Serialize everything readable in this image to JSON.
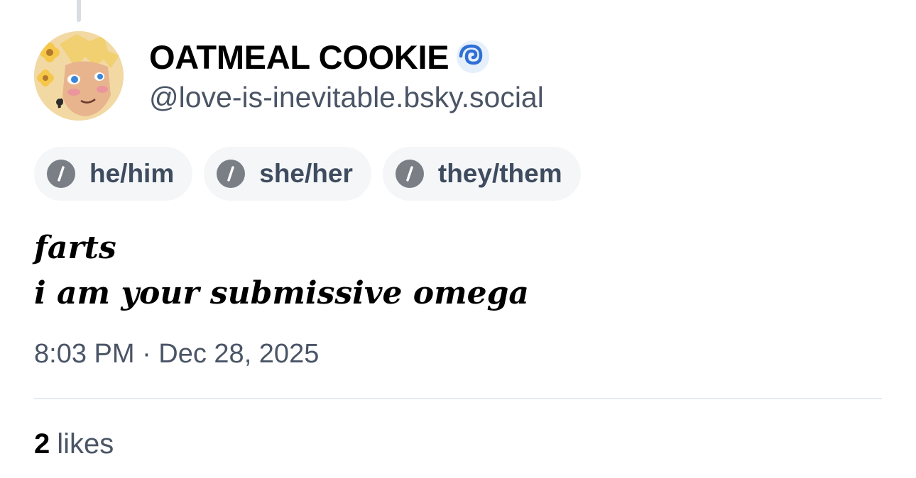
{
  "author": {
    "display_name": "OATMEAL COOKIE",
    "handle": "@love-is-inevitable.bsky.social",
    "name_emoji": "cyclone-icon"
  },
  "pronouns": [
    {
      "label": "he/him",
      "icon": "slash-icon"
    },
    {
      "label": "she/her",
      "icon": "slash-icon"
    },
    {
      "label": "they/them",
      "icon": "slash-icon"
    }
  ],
  "post": {
    "lines": [
      "farts",
      "i am your submissive omega"
    ],
    "timestamp": "8:03 PM · Dec 28, 2025"
  },
  "engagement": {
    "likes_count": "2",
    "likes_label": "likes"
  },
  "colors": {
    "text_primary": "#000000",
    "text_secondary": "#4a5566",
    "pill_background": "#f4f6f8",
    "pill_icon": "#7a7f86",
    "divider": "#e6e9ee",
    "thread_line": "#d9dde3",
    "cyclone": "#2f6fd6"
  }
}
